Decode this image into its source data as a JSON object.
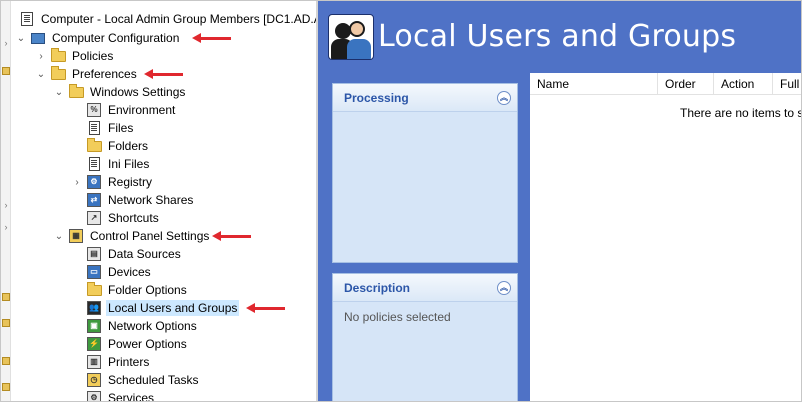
{
  "window": {
    "title": "Computer - Local Admin Group Members [DC1.AD.A"
  },
  "tree": {
    "items": [
      {
        "label": "Computer Configuration",
        "icon": "computer-config-icon",
        "expanded": true,
        "depth": 0
      },
      {
        "label": "Policies",
        "icon": "folder-icon",
        "expanded": false,
        "depth": 1
      },
      {
        "label": "Preferences",
        "icon": "folder-icon",
        "expanded": true,
        "depth": 1
      },
      {
        "label": "Windows Settings",
        "icon": "folder-icon",
        "expanded": true,
        "depth": 2
      },
      {
        "label": "Environment",
        "icon": "environment-icon",
        "depth": 3
      },
      {
        "label": "Files",
        "icon": "files-icon",
        "depth": 3
      },
      {
        "label": "Folders",
        "icon": "folders-icon",
        "depth": 3
      },
      {
        "label": "Ini Files",
        "icon": "ini-files-icon",
        "depth": 3
      },
      {
        "label": "Registry",
        "icon": "registry-icon",
        "expanded": false,
        "depth": 3
      },
      {
        "label": "Network Shares",
        "icon": "network-shares-icon",
        "depth": 3
      },
      {
        "label": "Shortcuts",
        "icon": "shortcuts-icon",
        "depth": 3
      },
      {
        "label": "Control Panel Settings",
        "icon": "control-panel-icon",
        "expanded": true,
        "depth": 2
      },
      {
        "label": "Data Sources",
        "icon": "data-sources-icon",
        "depth": 3
      },
      {
        "label": "Devices",
        "icon": "devices-icon",
        "depth": 3
      },
      {
        "label": "Folder Options",
        "icon": "folder-options-icon",
        "depth": 3
      },
      {
        "label": "Local Users and Groups",
        "icon": "local-users-groups-icon",
        "depth": 3,
        "selected": true
      },
      {
        "label": "Network Options",
        "icon": "network-options-icon",
        "depth": 3
      },
      {
        "label": "Power Options",
        "icon": "power-options-icon",
        "depth": 3
      },
      {
        "label": "Printers",
        "icon": "printers-icon",
        "depth": 3
      },
      {
        "label": "Scheduled Tasks",
        "icon": "scheduled-tasks-icon",
        "depth": 3
      },
      {
        "label": "Services",
        "icon": "services-icon",
        "depth": 3
      }
    ]
  },
  "annotation_color": "#e0282e",
  "main": {
    "banner_title": "Local Users and Groups",
    "background_color": "#4f72c6",
    "processing_panel": {
      "title": "Processing",
      "collapse_glyph": "︽"
    },
    "description_panel": {
      "title": "Description",
      "collapse_glyph": "︽",
      "text": "No policies selected"
    },
    "list": {
      "columns": [
        "Name",
        "Order",
        "Action",
        "Full"
      ],
      "empty_text": "There are no items to sh"
    }
  }
}
